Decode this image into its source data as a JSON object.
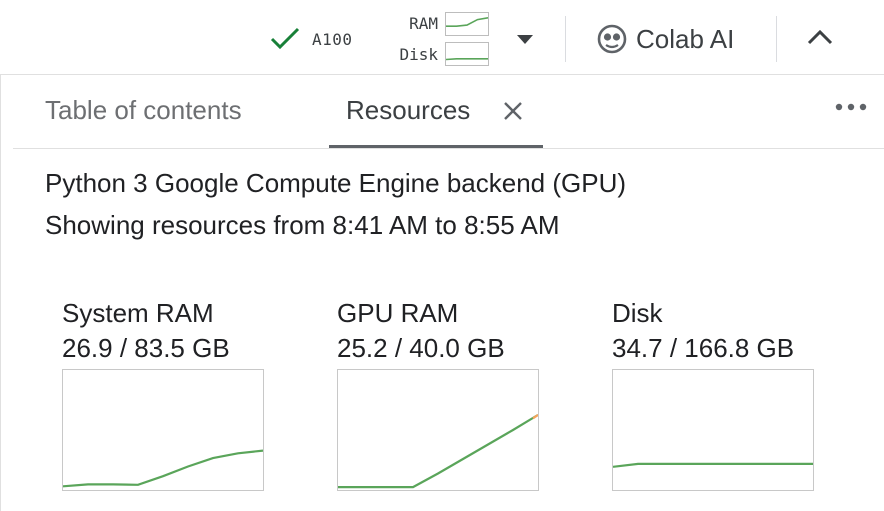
{
  "toolbar": {
    "runtime_label": "A100",
    "ram_label": "RAM",
    "disk_label": "Disk",
    "colab_ai_label": "Colab AI",
    "status_color": "#188038",
    "ram_spark": [
      0.6,
      0.6,
      0.55,
      0.3,
      0.22
    ],
    "disk_spark": [
      0.75,
      0.72,
      0.72,
      0.72,
      0.72
    ]
  },
  "panel": {
    "tabs": [
      {
        "label": "Table of contents",
        "active": false
      },
      {
        "label": "Resources",
        "active": true
      }
    ],
    "backend_line": "Python 3 Google Compute Engine backend (GPU)",
    "range_line": "Showing resources from 8:41 AM to 8:55 AM",
    "metrics": [
      {
        "title": "System RAM",
        "value": "26.9 / 83.5 GB",
        "used": 26.9,
        "total": 83.5,
        "series": [
          1.2,
          2.6,
          2.6,
          2.3,
          8.5,
          15.5,
          21.5,
          25.0,
          26.9
        ]
      },
      {
        "title": "GPU RAM",
        "value": "25.2 / 40.0 GB",
        "used": 25.2,
        "total": 40.0,
        "series": [
          0.3,
          0.3,
          0.3,
          0.3,
          5.0,
          10.0,
          15.0,
          20.0,
          25.2
        ]
      },
      {
        "title": "Disk",
        "value": "34.7 / 166.8 GB",
        "used": 34.7,
        "total": 166.8,
        "series": [
          30.5,
          34.7,
          34.7,
          34.7,
          34.7,
          34.7,
          34.7,
          34.7,
          34.7
        ]
      }
    ],
    "line_color": "#5aa55a",
    "warn_color": "#f6a35b"
  }
}
